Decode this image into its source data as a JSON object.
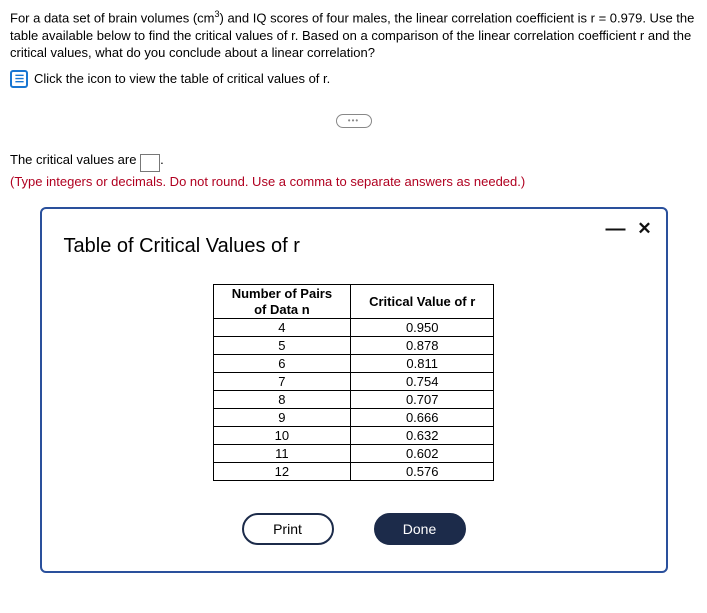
{
  "problem": {
    "text_html": "For a data set of brain volumes (cm<sup>3</sup>) and IQ scores of four males, the linear correlation coefficient is r = 0.979. Use the table available below to find the critical values of r. Based on a comparison of the linear correlation coefficient r and the critical values, what do you conclude about a linear correlation?"
  },
  "view_link": "Click the icon to view the table of critical values of r.",
  "expander": "•••",
  "answer": {
    "prefix": "The critical values are ",
    "suffix": ".",
    "value": "",
    "hint": "(Type integers or decimals. Do not round. Use a comma to separate answers as needed.)"
  },
  "modal": {
    "title": "Table of Critical Values of r",
    "header_left_line1": "Number of Pairs",
    "header_left_line2": "of Data n",
    "header_right": "Critical Value of r",
    "rows": [
      {
        "n": "4",
        "cv": "0.950"
      },
      {
        "n": "5",
        "cv": "0.878"
      },
      {
        "n": "6",
        "cv": "0.811"
      },
      {
        "n": "7",
        "cv": "0.754"
      },
      {
        "n": "8",
        "cv": "0.707"
      },
      {
        "n": "9",
        "cv": "0.666"
      },
      {
        "n": "10",
        "cv": "0.632"
      },
      {
        "n": "11",
        "cv": "0.602"
      },
      {
        "n": "12",
        "cv": "0.576"
      }
    ],
    "print_label": "Print",
    "done_label": "Done"
  },
  "chart_data": {
    "type": "table",
    "title": "Table of Critical Values of r",
    "columns": [
      "Number of Pairs of Data n",
      "Critical Value of r"
    ],
    "rows": [
      [
        4,
        0.95
      ],
      [
        5,
        0.878
      ],
      [
        6,
        0.811
      ],
      [
        7,
        0.754
      ],
      [
        8,
        0.707
      ],
      [
        9,
        0.666
      ],
      [
        10,
        0.632
      ],
      [
        11,
        0.602
      ],
      [
        12,
        0.576
      ]
    ]
  }
}
